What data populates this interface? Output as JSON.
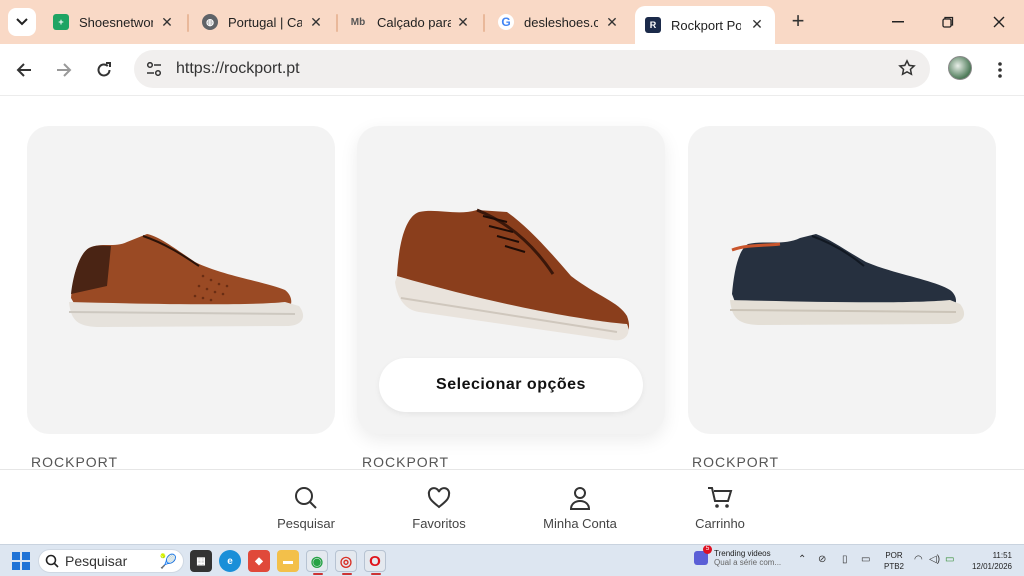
{
  "browser": {
    "tabs": [
      {
        "title": "Shoesnetwork",
        "favicon": "sheets-icon",
        "color": "#1fa463"
      },
      {
        "title": "Portugal | Ca",
        "favicon": "globe-icon",
        "color": "#5f6368"
      },
      {
        "title": "Calçado para",
        "favicon": "mb-icon",
        "color": "#555555"
      },
      {
        "title": "desleshoes.c",
        "favicon": "google-icon",
        "color": "#4285f4"
      },
      {
        "title": "Rockport Por",
        "favicon": "rockport-icon",
        "color": "#1b2a4a",
        "active": true
      }
    ],
    "url": "https://rockport.pt",
    "tab_strip_color": "#f9d9c6"
  },
  "products": [
    {
      "brand": "ROCKPORT",
      "image": "brown-leather-sneaker",
      "hovered": false
    },
    {
      "brand": "ROCKPORT",
      "image": "brown-derby-shoe",
      "hovered": true,
      "action_label": "Selecionar opções"
    },
    {
      "brand": "ROCKPORT",
      "image": "navy-sneaker",
      "hovered": false
    }
  ],
  "bottom_nav": [
    {
      "label": "Pesquisar",
      "icon": "search-icon"
    },
    {
      "label": "Favoritos",
      "icon": "heart-icon"
    },
    {
      "label": "Minha Conta",
      "icon": "user-icon"
    },
    {
      "label": "Carrinho",
      "icon": "cart-icon"
    }
  ],
  "taskbar": {
    "search_placeholder": "Pesquisar",
    "trending_title": "Trending videos",
    "trending_subtitle": "Qual a série com...",
    "trending_badge": "5",
    "lang_line1": "POR",
    "lang_line2": "PTB2",
    "time": "11:51",
    "date": "12/01/2026"
  }
}
